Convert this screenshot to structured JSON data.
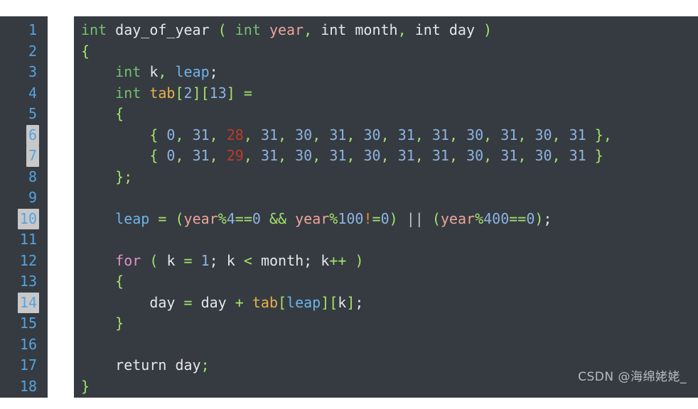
{
  "editor": {
    "language": "c",
    "theme": "dark",
    "background_color": "#353b41",
    "gutter_color": "#353b41",
    "line_number_color": "#56a3e0",
    "highlight_color": "#c8c8c8",
    "first_line": 1,
    "last_line": 18,
    "total_lines": 18,
    "highlighted_lines": [
      6,
      7,
      10,
      14
    ]
  },
  "line_numbers": [
    "1",
    "2",
    "3",
    "4",
    "5",
    "6",
    "7",
    "8",
    "9",
    "10",
    "11",
    "12",
    "13",
    "14",
    "15",
    "16",
    "17",
    "18"
  ],
  "code_lines": [
    {
      "n": "1",
      "text": "int day_of_year ( int year, int month, int day )"
    },
    {
      "n": "2",
      "text": "{"
    },
    {
      "n": "3",
      "text": "    int k, leap;"
    },
    {
      "n": "4",
      "text": "    int tab[2][13] ="
    },
    {
      "n": "5",
      "text": "    {"
    },
    {
      "n": "6",
      "text": "        { 0, 31, 28, 31, 30, 31, 30, 31, 31, 30, 31, 30, 31 },"
    },
    {
      "n": "7",
      "text": "        { 0, 31, 29, 31, 30, 31, 30, 31, 31, 30, 31, 30, 31 }"
    },
    {
      "n": "8",
      "text": "    };"
    },
    {
      "n": "9",
      "text": ""
    },
    {
      "n": "10",
      "text": "    leap = (year%4==0 && year%100!=0) || (year%400==0);"
    },
    {
      "n": "11",
      "text": ""
    },
    {
      "n": "12",
      "text": "    for ( k = 1; k < month; k++ )"
    },
    {
      "n": "13",
      "text": "    {"
    },
    {
      "n": "14",
      "text": "        day = day + tab[leap][k];"
    },
    {
      "n": "15",
      "text": "    }"
    },
    {
      "n": "16",
      "text": ""
    },
    {
      "n": "17",
      "text": "    return day;"
    },
    {
      "n": "18",
      "text": "}"
    }
  ],
  "tokens": {
    "l1": [
      "int",
      " ",
      "day_of_year",
      " ",
      "(",
      " ",
      "int",
      " ",
      "year",
      ",",
      " ",
      "int",
      " ",
      "month",
      ",",
      " ",
      "int",
      " ",
      "day",
      " ",
      ")"
    ],
    "l2": [
      "{"
    ],
    "l3": [
      "    ",
      "int",
      " ",
      "k",
      ",",
      " ",
      "leap",
      ";"
    ],
    "l4": [
      "    ",
      "int",
      " ",
      "tab",
      "[",
      "2",
      "]",
      "[",
      "13",
      "]",
      " ",
      "="
    ],
    "l5": [
      "    ",
      "{"
    ],
    "l6_values": [
      "0",
      "31",
      "28",
      "31",
      "30",
      "31",
      "30",
      "31",
      "31",
      "30",
      "31",
      "30",
      "31"
    ],
    "l7_values": [
      "0",
      "31",
      "29",
      "31",
      "30",
      "31",
      "30",
      "31",
      "31",
      "30",
      "31",
      "30",
      "31"
    ],
    "l8": [
      "    ",
      "}",
      ";"
    ],
    "l10": [
      "    ",
      "leap",
      " ",
      "=",
      " ",
      "(",
      "year",
      "%",
      "4",
      "==",
      "0",
      " ",
      "&&",
      " ",
      "year",
      "%",
      "100",
      "!",
      "=",
      "0",
      ")",
      " ",
      "||",
      " ",
      "(",
      "year",
      "%",
      "400",
      "==",
      "0",
      ")",
      ";"
    ],
    "l12": [
      "    ",
      "for",
      " ",
      "(",
      " ",
      "k",
      " ",
      "=",
      " ",
      "1",
      ";",
      " ",
      "k",
      " ",
      "<",
      " ",
      "month",
      ";",
      " ",
      "k",
      "++",
      " ",
      ")"
    ],
    "l13": [
      "    ",
      "{"
    ],
    "l14": [
      "        ",
      "day",
      " ",
      "=",
      " ",
      "day",
      " ",
      "+",
      " ",
      "tab",
      "[",
      "leap",
      "]",
      "[",
      "k",
      "]",
      ";"
    ],
    "l15": [
      "    ",
      "}"
    ],
    "l17": [
      "    ",
      "return",
      " ",
      "day",
      ";"
    ],
    "l18": [
      "}"
    ]
  },
  "watermark": {
    "text": "CSDN @海绵姥姥_",
    "color": "#b8bcc0"
  }
}
